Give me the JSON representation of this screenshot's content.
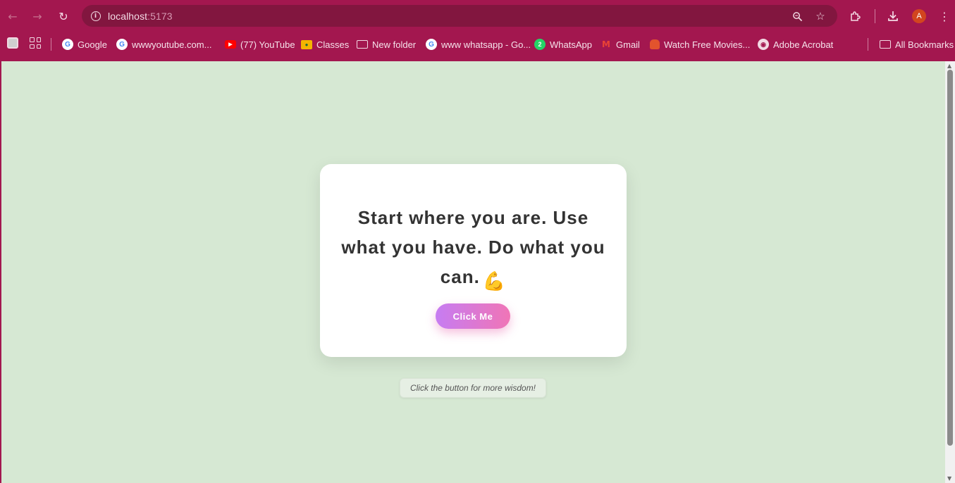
{
  "browser": {
    "url_host": "localhost",
    "url_port": ":5173",
    "profile_initial": "A"
  },
  "bookmarks": {
    "items": [
      {
        "label": "Google",
        "icon": "google-icon"
      },
      {
        "label": "wwwyoutube.com...",
        "icon": "google-icon"
      },
      {
        "label": "(77) YouTube",
        "icon": "youtube-icon"
      },
      {
        "label": "Classes",
        "icon": "classroom-icon"
      },
      {
        "label": "New folder",
        "icon": "folder-icon"
      },
      {
        "label": "www whatsapp - Go...",
        "icon": "google-icon"
      },
      {
        "label": "WhatsApp",
        "icon": "whatsapp-icon",
        "badge": "2"
      },
      {
        "label": "Gmail",
        "icon": "gmail-icon"
      },
      {
        "label": "Watch Free Movies...",
        "icon": "movie-icon"
      },
      {
        "label": "Adobe Acrobat",
        "icon": "globe-icon"
      }
    ],
    "all_bookmarks": "All Bookmarks"
  },
  "page": {
    "quote": "Start where you are. Use what you have. Do what you can.",
    "emoji": "💪",
    "button_label": "Click Me",
    "hint": "Click the button for more wisdom!"
  },
  "colors": {
    "browser_chrome": "#a3174f",
    "page_background": "#d6e8d3",
    "button_gradient_start": "#c67cf2",
    "button_gradient_end": "#f075b6"
  }
}
